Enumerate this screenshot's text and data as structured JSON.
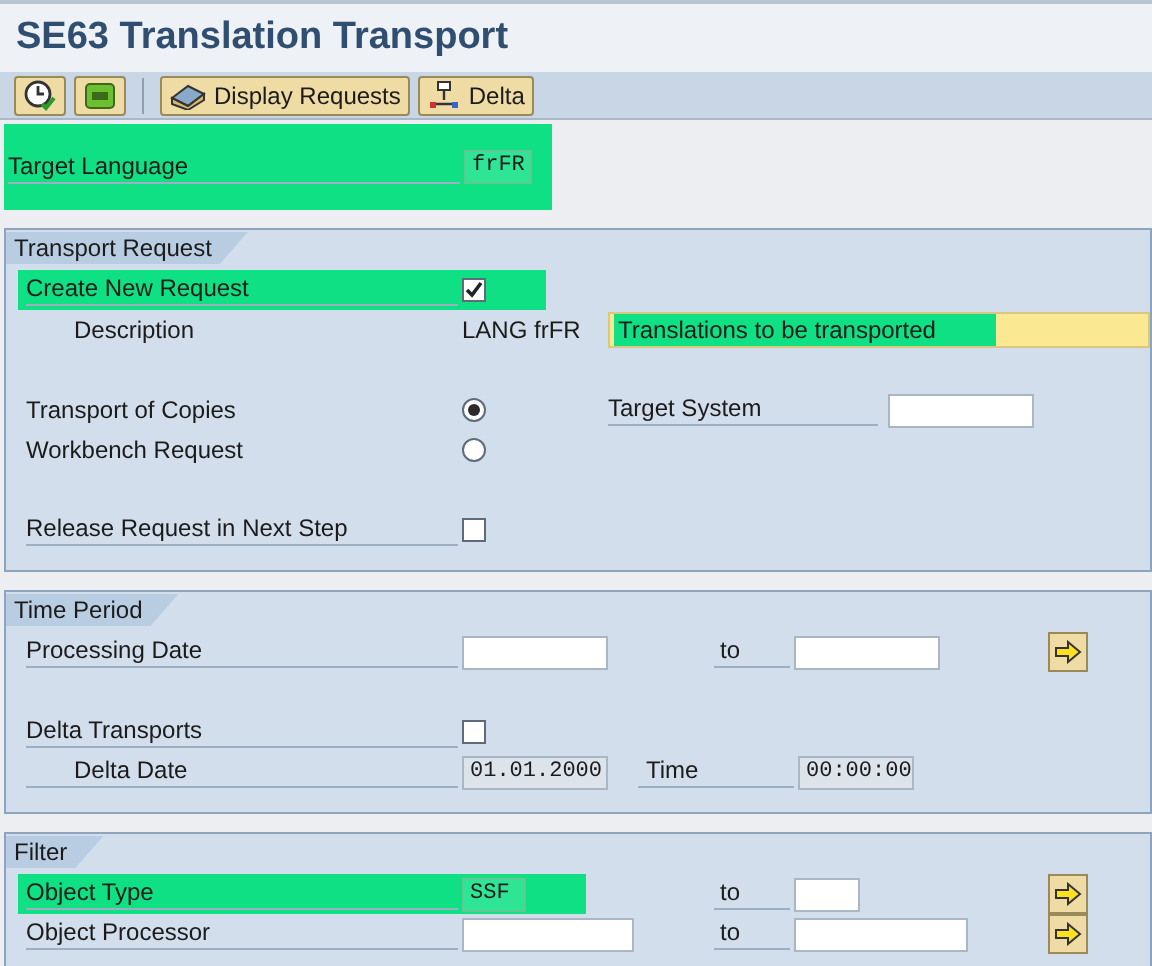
{
  "title": "SE63 Translation Transport",
  "toolbar": [
    {
      "kind": "icon"
    },
    {
      "kind": "icon"
    },
    {
      "kind": "button",
      "label": "Display Requests"
    },
    {
      "kind": "button",
      "label": "Delta"
    }
  ],
  "target_language": {
    "label": "Target Language",
    "value": "frFR",
    "highlighted": true
  },
  "groups": [
    {
      "title": "Transport Request",
      "rows": [
        {
          "kind": "checkbox",
          "label": "Create New Request",
          "checked": true,
          "highlighted": true
        },
        {
          "kind": "description",
          "label": "Description",
          "prefix": "LANG frFR",
          "value": "Translations to be transported",
          "highlighted": true
        },
        {
          "kind": "radio",
          "label": "Transport of Copies",
          "selected": true,
          "side_label": "Target System"
        },
        {
          "kind": "radio",
          "label": "Workbench Request",
          "selected": false
        },
        {
          "kind": "checkbox",
          "label": "Release Request in Next Step",
          "checked": false,
          "highlighted": false
        }
      ]
    },
    {
      "title": "Time Period",
      "rows": [
        {
          "kind": "range",
          "label": "Processing Date",
          "to_label": "to",
          "highlighted": false
        },
        {
          "kind": "checkbox",
          "label": "Delta Transports",
          "checked": false,
          "highlighted": false
        },
        {
          "kind": "datetime",
          "label": "Delta Date",
          "value": "01.01.2000",
          "time_label": "Time",
          "time_value": "00:00:00"
        }
      ]
    },
    {
      "title": "Filter",
      "rows": [
        {
          "kind": "range",
          "label": "Object Type",
          "value": "SSF",
          "to_label": "to",
          "highlighted": true
        },
        {
          "kind": "range",
          "label": "Object Processor",
          "to_label": "to",
          "highlighted": false
        }
      ]
    }
  ]
}
